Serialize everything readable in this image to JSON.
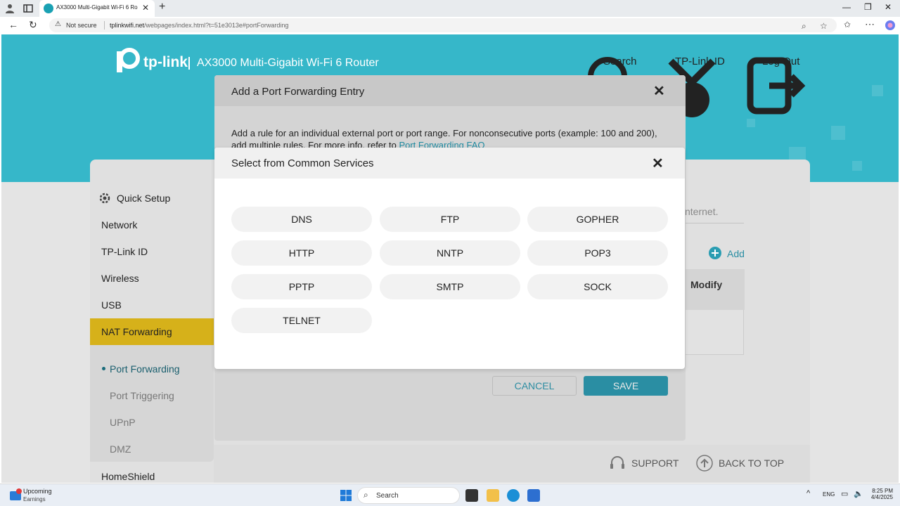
{
  "browser": {
    "tab_title": "AX3000 Multi-Gigabit Wi-Fi 6 Rou",
    "address": {
      "security": "Not secure",
      "host": "tplinkwifi.net",
      "path": "/webpages/index.html?t=51e3013e#portForwarding"
    }
  },
  "header": {
    "brand": "tp-link",
    "product": "AX3000 Multi-Gigabit Wi-Fi 6 Router",
    "links": [
      "Search",
      "TP-Link ID",
      "Log Out"
    ]
  },
  "sidebar": {
    "items": [
      "Quick Setup",
      "Network",
      "TP-Link ID",
      "Wireless",
      "USB",
      "NAT Forwarding"
    ],
    "subitems": [
      "Port Forwarding",
      "Port Triggering",
      "UPnP",
      "DMZ"
    ],
    "bottom": "HomeShield",
    "active": "NAT Forwarding",
    "active_sub": "Port Forwarding"
  },
  "content_fragments": {
    "internet": "nternet.",
    "add": "Add",
    "modify": "Modify"
  },
  "footer": {
    "support": "SUPPORT",
    "back_to_top": "BACK TO TOP"
  },
  "dialog_entry": {
    "title": "Add a Port Forwarding Entry",
    "description": "Add a rule for an individual external port or port range. For nonconsecutive ports (example: 100 and 200), add multiple rules. For more info, refer to ",
    "link": "Port Forwarding FAQ",
    "cancel": "CANCEL",
    "save": "SAVE"
  },
  "dialog_services": {
    "title": "Select from Common Services",
    "services": [
      "DNS",
      "FTP",
      "GOPHER",
      "HTTP",
      "NNTP",
      "POP3",
      "PPTP",
      "SMTP",
      "SOCK",
      "TELNET"
    ]
  },
  "taskbar": {
    "weather_title": "Upcoming",
    "weather_sub": "Earnings",
    "search": "Search",
    "lang": "ENG",
    "time": "8:25 PM",
    "date": "4/4/2025"
  },
  "colors": {
    "brand_teal": "#36b7c9",
    "active_yellow": "#d6b11a",
    "save_button": "#2a8ea3"
  }
}
